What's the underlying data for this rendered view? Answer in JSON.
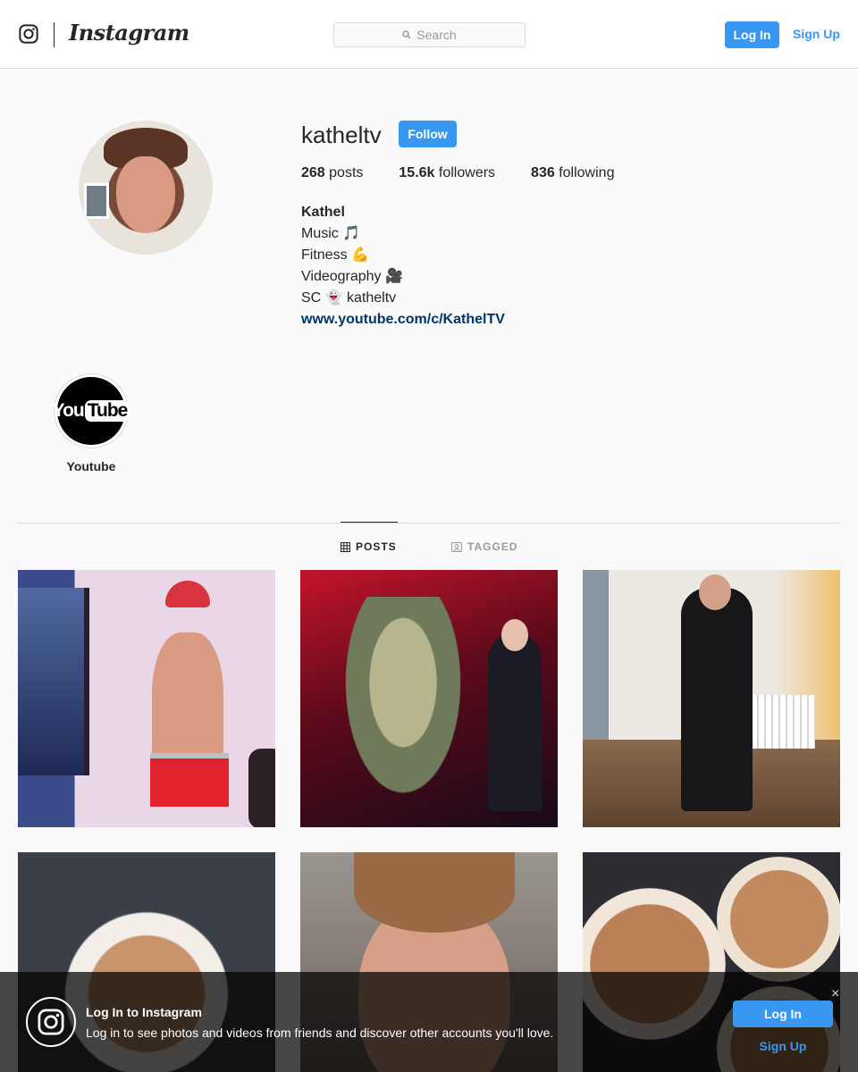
{
  "nav": {
    "wordmark": "Instagram",
    "search_placeholder": "Search",
    "login_label": "Log In",
    "signup_label": "Sign Up",
    "icons": {
      "logo": "instagram-glyph-icon",
      "search": "search-icon"
    }
  },
  "profile": {
    "username": "katheltv",
    "follow_label": "Follow",
    "stats": {
      "posts_count": "268",
      "posts_label": "posts",
      "followers_count": "15.6k",
      "followers_label": "followers",
      "following_count": "836",
      "following_label": "following"
    },
    "bio": {
      "name": "Kathel",
      "lines": [
        "Music 🎵",
        "Fitness 💪",
        "Videography 🎥",
        "SC 👻 katheltv"
      ],
      "link": "www.youtube.com/c/KathelTV"
    }
  },
  "highlights": [
    {
      "label": "Youtube",
      "logo_text_you": "You",
      "logo_text_tube": "Tube"
    }
  ],
  "tabs": [
    {
      "label": "POSTS",
      "icon": "grid-icon",
      "active": true
    },
    {
      "label": "TAGGED",
      "icon": "tagged-icon",
      "active": false
    }
  ],
  "banner": {
    "title": "Log In to Instagram",
    "text": "Log in to see photos and videos from friends and discover other accounts you'll love.",
    "login_label": "Log In",
    "signup_label": "Sign Up",
    "close_glyph": "×"
  },
  "colors": {
    "accent": "#3897f0",
    "link": "#003569",
    "text": "#262626",
    "border": "#dbdbdb"
  }
}
